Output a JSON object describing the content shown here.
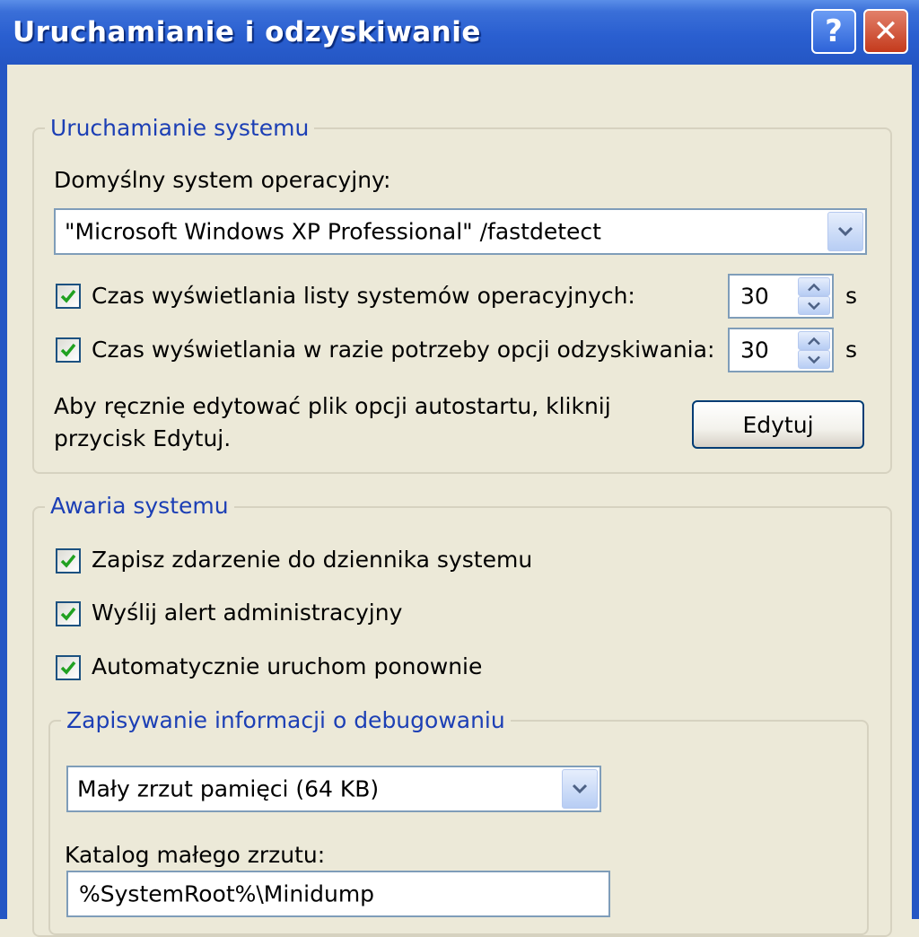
{
  "window": {
    "title": "Uruchamianie i odzyskiwanie",
    "help_label": "?",
    "close_label": "✕"
  },
  "startup": {
    "group_title": "Uruchamianie systemu",
    "default_os_label": "Domyślny system operacyjny:",
    "default_os_value": "\"Microsoft Windows XP Professional\" /fastdetect",
    "show_list_label": "Czas wyświetlania listy systemów operacyjnych:",
    "show_list_checked": true,
    "show_list_value": "30",
    "show_recovery_label": "Czas wyświetlania w razie potrzeby opcji odzyskiwania:",
    "show_recovery_checked": true,
    "show_recovery_value": "30",
    "unit": "s",
    "edit_hint_line1": "Aby ręcznie edytować plik opcji autostartu, kliknij",
    "edit_hint_line2": "przycisk Edytuj.",
    "edit_button": "Edytuj"
  },
  "failure": {
    "group_title": "Awaria systemu",
    "log_event_label": "Zapisz zdarzenie do dziennika systemu",
    "log_event_checked": true,
    "send_alert_label": "Wyślij alert administracyjny",
    "send_alert_checked": true,
    "auto_restart_label": "Automatycznie uruchom ponownie",
    "auto_restart_checked": true,
    "debug": {
      "group_title": "Zapisywanie informacji o debugowaniu",
      "dump_type_value": "Mały zrzut pamięci (64 KB)",
      "dump_dir_label": "Katalog małego zrzutu:",
      "dump_dir_value": "%SystemRoot%\\Minidump"
    }
  },
  "colors": {
    "titlebar": "#2456c4",
    "dialog_bg": "#ece9d8",
    "legend_text": "#1c3fb5",
    "check_mark": "#21a121"
  }
}
